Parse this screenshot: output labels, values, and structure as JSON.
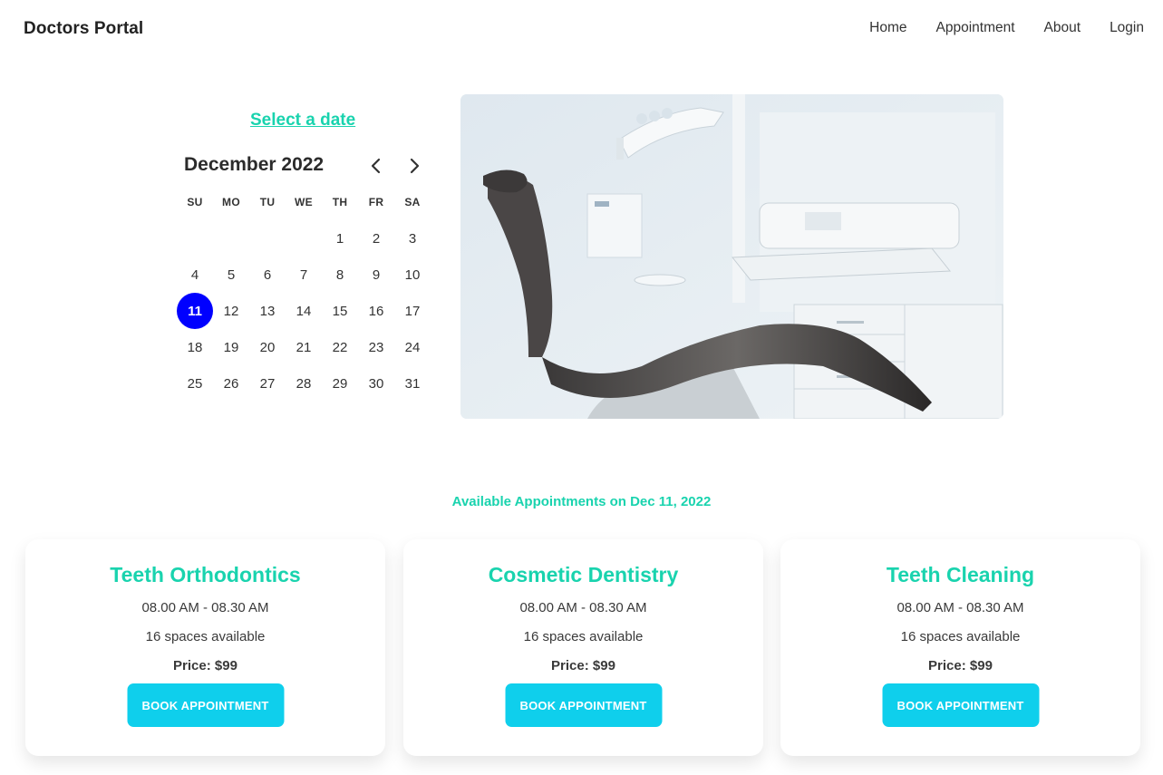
{
  "navbar": {
    "brand": "Doctors Portal",
    "links": [
      "Home",
      "Appointment",
      "About",
      "Login"
    ]
  },
  "calendar": {
    "select_label": "Select a date",
    "month_label": "December 2022",
    "weekdays": [
      "SU",
      "MO",
      "TU",
      "WE",
      "TH",
      "FR",
      "SA"
    ],
    "weeks": [
      [
        "",
        "",
        "",
        "",
        "1",
        "2",
        "3"
      ],
      [
        "4",
        "5",
        "6",
        "7",
        "8",
        "9",
        "10"
      ],
      [
        "11",
        "12",
        "13",
        "14",
        "15",
        "16",
        "17"
      ],
      [
        "18",
        "19",
        "20",
        "21",
        "22",
        "23",
        "24"
      ],
      [
        "25",
        "26",
        "27",
        "28",
        "29",
        "30",
        "31"
      ]
    ],
    "selected_day": "11",
    "selected_color": "#0000ff",
    "prev_icon": "chevron-left-icon",
    "next_icon": "chevron-right-icon"
  },
  "hero": {
    "image": "dental-chair-image"
  },
  "appointments": {
    "title": "Available Appointments on Dec 11, 2022",
    "accent_color": "#19d3ae",
    "button_color": "#0fcfec",
    "cards": [
      {
        "title": "Teeth Orthodontics",
        "time": "08.00 AM - 08.30 AM",
        "spaces": "16 spaces available",
        "price": "Price: $99",
        "button": "BOOK APPOINTMENT"
      },
      {
        "title": "Cosmetic Dentistry",
        "time": "08.00 AM - 08.30 AM",
        "spaces": "16 spaces available",
        "price": "Price: $99",
        "button": "BOOK APPOINTMENT"
      },
      {
        "title": "Teeth Cleaning",
        "time": "08.00 AM - 08.30 AM",
        "spaces": "16 spaces available",
        "price": "Price: $99",
        "button": "BOOK APPOINTMENT"
      }
    ]
  }
}
